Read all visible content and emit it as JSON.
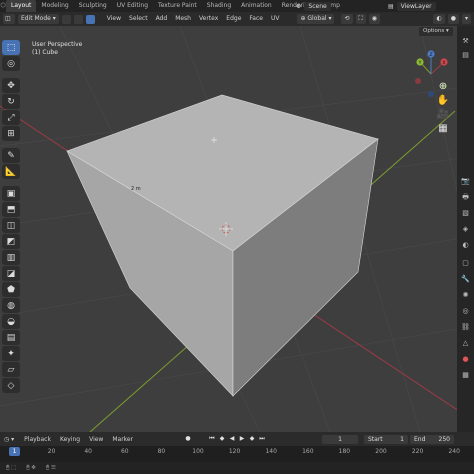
{
  "workspace_tabs": [
    "Layout",
    "Modeling",
    "Sculpting",
    "UV Editing",
    "Texture Paint",
    "Shading",
    "Animation",
    "Rendering",
    "Comp"
  ],
  "active_tab_index": 0,
  "scene": {
    "label": "Scene",
    "view_layer": "ViewLayer"
  },
  "header": {
    "mode": "Edit Mode",
    "menus": [
      "View",
      "Select",
      "Add",
      "Mesh",
      "Vertex",
      "Edge",
      "Face",
      "UV"
    ],
    "transform_orientation": "Global",
    "options_label": "Options"
  },
  "viewport": {
    "info_line1": "User Perspective",
    "info_line2": "(1) Cube",
    "dimension_label": "2 m",
    "gizmo_axes": [
      "X",
      "Y",
      "Z"
    ]
  },
  "toolbar_tools": [
    {
      "icon": "select-box-icon",
      "glyph": "⬚",
      "active": true
    },
    {
      "icon": "cursor-icon",
      "glyph": "◎",
      "active": false
    },
    {
      "icon": "move-icon",
      "glyph": "✥",
      "active": false
    },
    {
      "icon": "rotate-icon",
      "glyph": "↻",
      "active": false
    },
    {
      "icon": "scale-icon",
      "glyph": "⤢",
      "active": false
    },
    {
      "icon": "transform-icon",
      "glyph": "⊞",
      "active": false
    },
    {
      "icon": "annotate-icon",
      "glyph": "✎",
      "active": false
    },
    {
      "icon": "measure-icon",
      "glyph": "📐",
      "active": false
    },
    {
      "icon": "add-cube-icon",
      "glyph": "▣",
      "active": false
    },
    {
      "icon": "extrude-icon",
      "glyph": "⬒",
      "active": false
    },
    {
      "icon": "inset-icon",
      "glyph": "◫",
      "active": false
    },
    {
      "icon": "bevel-icon",
      "glyph": "◩",
      "active": false
    },
    {
      "icon": "loop-cut-icon",
      "glyph": "▥",
      "active": false
    },
    {
      "icon": "knife-icon",
      "glyph": "◪",
      "active": false
    },
    {
      "icon": "poly-build-icon",
      "glyph": "⬟",
      "active": false
    },
    {
      "icon": "spin-icon",
      "glyph": "◍",
      "active": false
    },
    {
      "icon": "smooth-icon",
      "glyph": "◒",
      "active": false
    },
    {
      "icon": "edge-slide-icon",
      "glyph": "▤",
      "active": false
    },
    {
      "icon": "shrink-fatten-icon",
      "glyph": "✦",
      "active": false
    },
    {
      "icon": "shear-icon",
      "glyph": "▱",
      "active": false
    },
    {
      "icon": "rip-icon",
      "glyph": "◇",
      "active": false
    }
  ],
  "timeline": {
    "menus": [
      "Playback",
      "Keying",
      "View",
      "Marker"
    ],
    "current_frame": "1",
    "start_label": "Start",
    "start_value": "1",
    "end_label": "End",
    "end_value": "250",
    "ticks": [
      "1",
      "20",
      "40",
      "60",
      "80",
      "100",
      "120",
      "140",
      "160",
      "180",
      "200",
      "220",
      "240"
    ]
  },
  "colors": {
    "viewport_bg": "#3e3e3e",
    "grid_line": "#4a4a4a",
    "x_axis": "#9c3b45",
    "y_axis": "#7b9d2e",
    "accent": "#4772b3",
    "cube_top": "#b4b4b4",
    "cube_left": "#a6a6a6",
    "cube_right": "#7d7d7d"
  }
}
